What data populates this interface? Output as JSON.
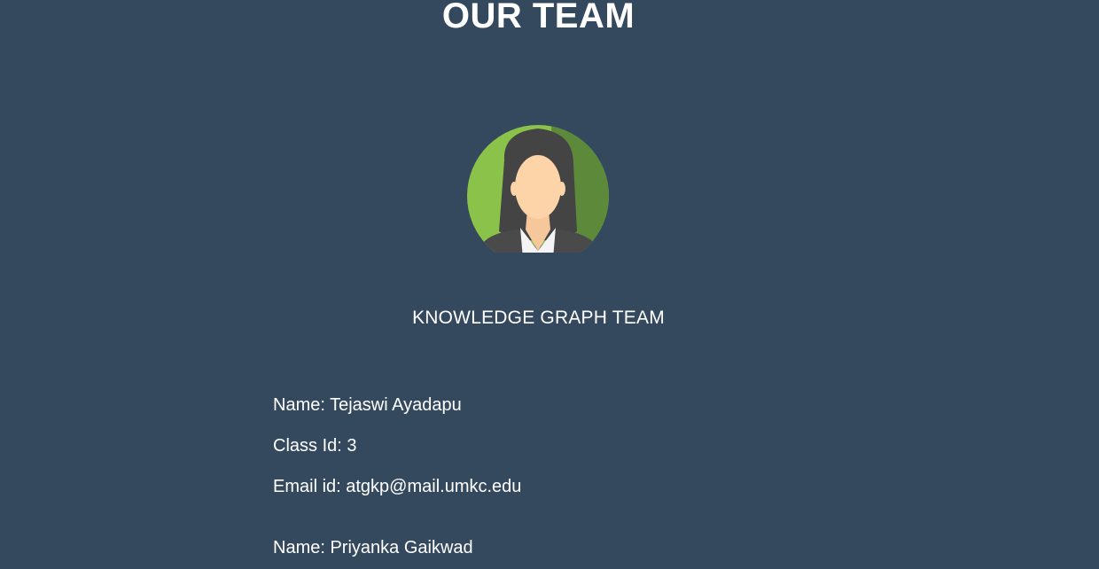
{
  "page": {
    "title": "OUR TEAM",
    "background_color": "#34495e"
  },
  "team": {
    "name": "KNOWLEDGE GRAPH TEAM",
    "avatar_icon": "female-avatar-icon"
  },
  "members": [
    {
      "name": "Name: Tejaswi Ayadapu",
      "class_id": "Class Id: 3",
      "email": "Email id: atgkp@mail.umkc.edu"
    },
    {
      "name": "Name: Priyanka Gaikwad"
    }
  ]
}
